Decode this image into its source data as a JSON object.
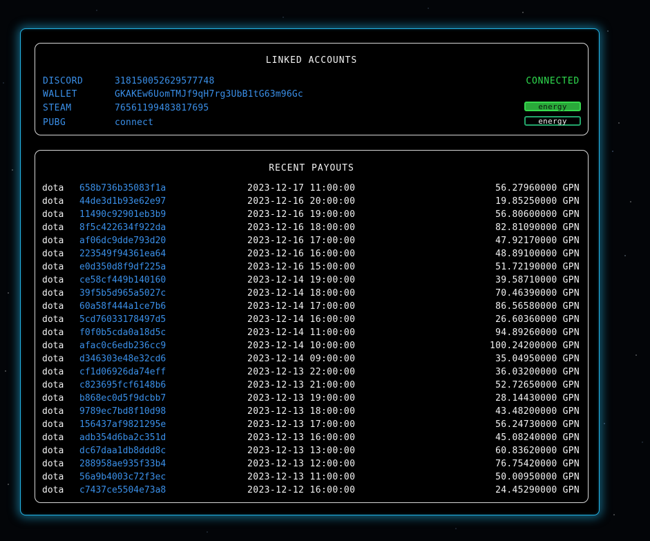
{
  "linked_accounts": {
    "title": "LINKED ACCOUNTS",
    "rows": [
      {
        "label": "DISCORD",
        "value": "318150052629577748",
        "status": "CONNECTED"
      },
      {
        "label": "WALLET",
        "value": "GKAKEw6UomTMJf9qH7rg3UbB1tG63m96Gc"
      },
      {
        "label": "STEAM",
        "value": "76561199483817695",
        "button": "energy",
        "button_style": "filled"
      },
      {
        "label": "PUBG",
        "value": "connect",
        "button": "energy",
        "button_style": "outline"
      }
    ]
  },
  "recent_payouts": {
    "title": "RECENT PAYOUTS",
    "rows": [
      {
        "game": "dota",
        "tx": "658b736b35083f1a",
        "time": "2023-12-17 11:00:00",
        "amount": "56.27960000 GPN"
      },
      {
        "game": "dota",
        "tx": "44de3d1b93e62e97",
        "time": "2023-12-16 20:00:00",
        "amount": "19.85250000 GPN"
      },
      {
        "game": "dota",
        "tx": "11490c92901eb3b9",
        "time": "2023-12-16 19:00:00",
        "amount": "56.80600000 GPN"
      },
      {
        "game": "dota",
        "tx": "8f5c422634f922da",
        "time": "2023-12-16 18:00:00",
        "amount": "82.81090000 GPN"
      },
      {
        "game": "dota",
        "tx": "af06dc9dde793d20",
        "time": "2023-12-16 17:00:00",
        "amount": "47.92170000 GPN"
      },
      {
        "game": "dota",
        "tx": "223549f94361ea64",
        "time": "2023-12-16 16:00:00",
        "amount": "48.89100000 GPN"
      },
      {
        "game": "dota",
        "tx": "e0d350d8f9df225a",
        "time": "2023-12-16 15:00:00",
        "amount": "51.72190000 GPN"
      },
      {
        "game": "dota",
        "tx": "ce58cf449b140160",
        "time": "2023-12-14 19:00:00",
        "amount": "39.58710000 GPN"
      },
      {
        "game": "dota",
        "tx": "39f5b5d965a5027c",
        "time": "2023-12-14 18:00:00",
        "amount": "70.46390000 GPN"
      },
      {
        "game": "dota",
        "tx": "60a58f444a1ce7b6",
        "time": "2023-12-14 17:00:00",
        "amount": "86.56580000 GPN"
      },
      {
        "game": "dota",
        "tx": "5cd76033178497d5",
        "time": "2023-12-14 16:00:00",
        "amount": "26.60360000 GPN"
      },
      {
        "game": "dota",
        "tx": "f0f0b5cda0a18d5c",
        "time": "2023-12-14 11:00:00",
        "amount": "94.89260000 GPN"
      },
      {
        "game": "dota",
        "tx": "afac0c6edb236cc9",
        "time": "2023-12-14 10:00:00",
        "amount": "100.24200000 GPN"
      },
      {
        "game": "dota",
        "tx": "d346303e48e32cd6",
        "time": "2023-12-14 09:00:00",
        "amount": "35.04950000 GPN"
      },
      {
        "game": "dota",
        "tx": "cf1d06926da74eff",
        "time": "2023-12-13 22:00:00",
        "amount": "36.03200000 GPN"
      },
      {
        "game": "dota",
        "tx": "c823695fcf6148b6",
        "time": "2023-12-13 21:00:00",
        "amount": "52.72650000 GPN"
      },
      {
        "game": "dota",
        "tx": "b868ec0d5f9dcbb7",
        "time": "2023-12-13 19:00:00",
        "amount": "28.14430000 GPN"
      },
      {
        "game": "dota",
        "tx": "9789ec7bd8f10d98",
        "time": "2023-12-13 18:00:00",
        "amount": "43.48200000 GPN"
      },
      {
        "game": "dota",
        "tx": "156437af9821295e",
        "time": "2023-12-13 17:00:00",
        "amount": "56.24730000 GPN"
      },
      {
        "game": "dota",
        "tx": "adb354d6ba2c351d",
        "time": "2023-12-13 16:00:00",
        "amount": "45.08240000 GPN"
      },
      {
        "game": "dota",
        "tx": "dc67daa1db8ddd8c",
        "time": "2023-12-13 13:00:00",
        "amount": "60.83620000 GPN"
      },
      {
        "game": "dota",
        "tx": "288958ae935f33b4",
        "time": "2023-12-13 12:00:00",
        "amount": "76.75420000 GPN"
      },
      {
        "game": "dota",
        "tx": "56a9b4003c72f3ec",
        "time": "2023-12-13 11:00:00",
        "amount": "50.00950000 GPN"
      },
      {
        "game": "dota",
        "tx": "c7437ce5504e73a8",
        "time": "2023-12-12 16:00:00",
        "amount": "24.45290000 GPN"
      }
    ]
  },
  "colors": {
    "accent_blue": "#3a8fe8",
    "panel_glow": "#23b4e6",
    "connected_green": "#2fdc4f",
    "text_white": "#f2f2f2"
  }
}
